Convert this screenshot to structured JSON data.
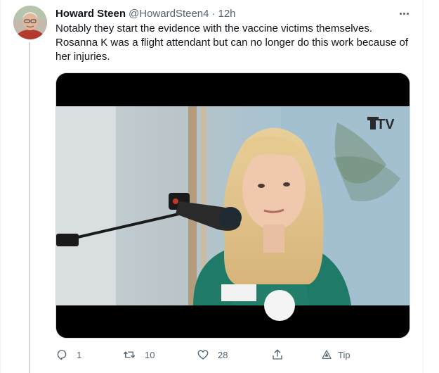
{
  "tweet": {
    "author_name": "Howard Steen",
    "author_handle": "@HowardSteen4",
    "separator": "·",
    "timestamp": "12h",
    "text_lines": [
      "Notably they start the evidence with the vaccine victims themselves.",
      "Rosanna K was a flight attendant but can no longer do this work because of",
      "her injuries."
    ],
    "media": {
      "watermark": "TV",
      "description_icon": "video-still"
    },
    "actions": {
      "reply_count": "1",
      "retweet_count": "10",
      "like_count": "28",
      "tip_label": "Tip"
    }
  },
  "colors": {
    "text_primary": "#0f1419",
    "text_secondary": "#536471",
    "thread_line": "#cfd9de",
    "border": "#eff3f4",
    "dress": "#1f7a68",
    "backdrop": "#a9c5d3"
  },
  "icons": [
    "more-icon",
    "reply-icon",
    "retweet-icon",
    "like-icon",
    "share-icon",
    "tip-icon"
  ]
}
